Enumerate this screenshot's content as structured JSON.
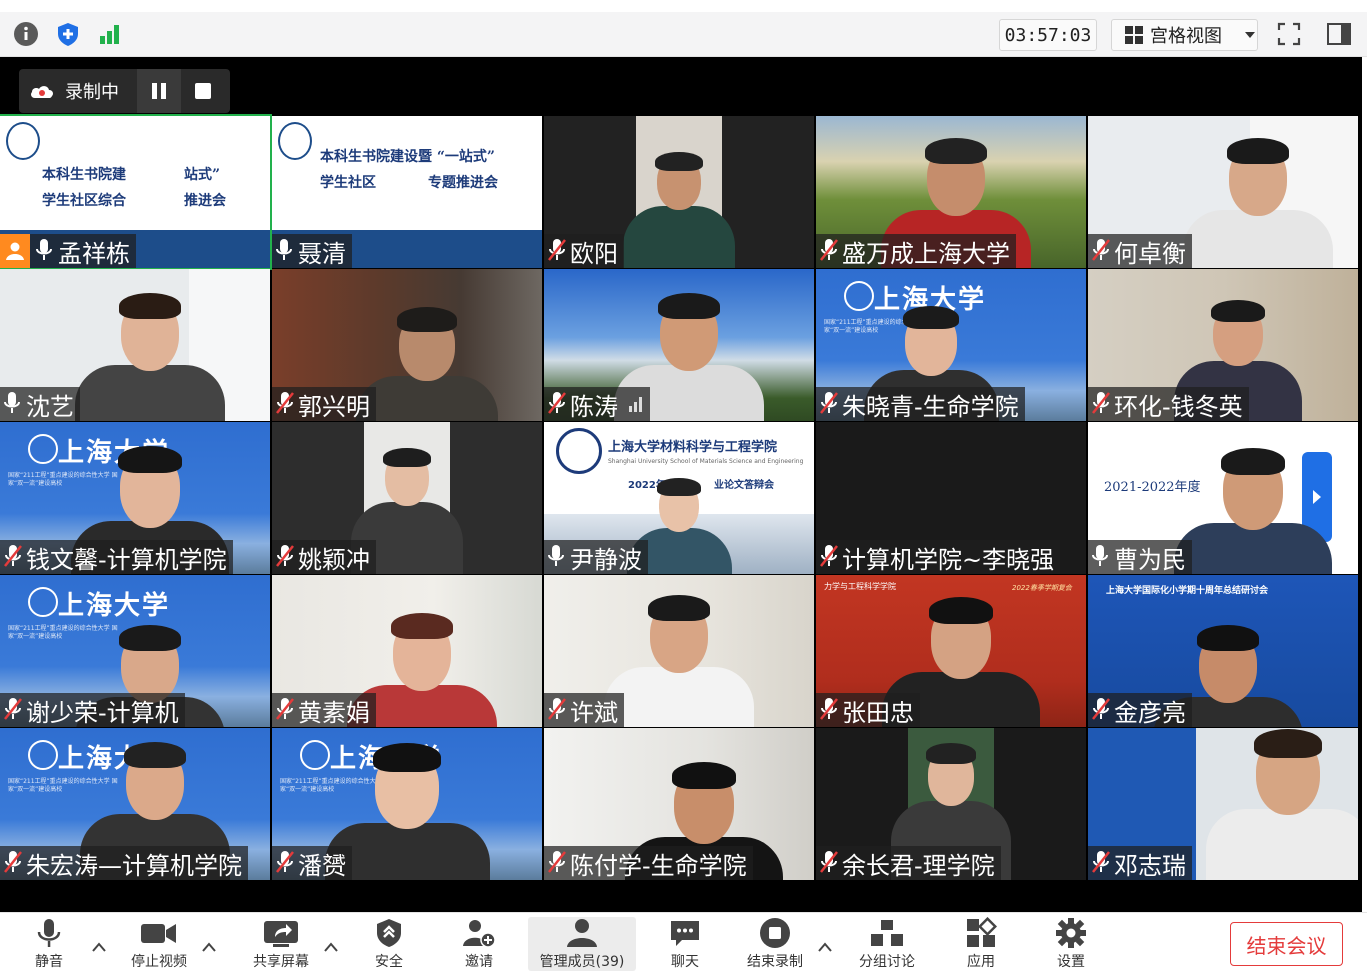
{
  "topbar": {
    "timer": "03:57:03",
    "view_label": "宫格视图",
    "icons": [
      "info-icon",
      "shield-icon",
      "signal-icon",
      "grid-icon",
      "fullscreen-icon",
      "sidebar-toggle-icon"
    ]
  },
  "recording": {
    "label": "录制中"
  },
  "participants": [
    {
      "name": "孟祥栋",
      "muted": false,
      "host": true
    },
    {
      "name": "聂清",
      "muted": false
    },
    {
      "name": "欧阳",
      "muted": true
    },
    {
      "name": "盛万成上海大学",
      "muted": true
    },
    {
      "name": "何卓衡",
      "muted": true
    },
    {
      "name": "沈艺",
      "muted": false
    },
    {
      "name": "郭兴明",
      "muted": true
    },
    {
      "name": "陈涛",
      "muted": true,
      "signal": true
    },
    {
      "name": "朱晓青-生命学院",
      "muted": true
    },
    {
      "name": "环化-钱冬英",
      "muted": true
    },
    {
      "name": "钱文馨-计算机学院",
      "muted": true
    },
    {
      "name": "姚颖冲",
      "muted": true
    },
    {
      "name": "尹静波",
      "muted": false
    },
    {
      "name": "计算机学院~李晓强",
      "muted": true
    },
    {
      "name": "曹为民",
      "muted": false
    },
    {
      "name": "谢少荣-计算机",
      "muted": true
    },
    {
      "name": "黄素娟",
      "muted": true
    },
    {
      "name": "许斌",
      "muted": true
    },
    {
      "name": "张田忠",
      "muted": true
    },
    {
      "name": "金彦亮",
      "muted": true
    },
    {
      "name": "朱宏涛—计算机学院",
      "muted": true
    },
    {
      "name": "潘赟",
      "muted": true
    },
    {
      "name": "陈付学-生命学院",
      "muted": true
    },
    {
      "name": "余长君-理学院",
      "muted": true
    },
    {
      "name": "邓志瑞",
      "muted": true
    }
  ],
  "slides": {
    "t1_line1": "本科生书院建",
    "t1_line1b": "站式”",
    "t1_line2": "学生社区综合",
    "t1_line2b": "推进会",
    "t2_line1": "本科生书院建设暨 “一站式”",
    "t2_line2": "学生社区",
    "t2_line2b": "专题推进会",
    "shu": "上海大学",
    "mat_title": "上海大学材料科学与工程学院",
    "mat_sub": "Shanghai University School of Materials Science and Engineering",
    "mat_year": "2022年",
    "mat_event": "业论文答辩会",
    "cs_year": "2021-2022年度",
    "mech": "力学与工程科学学院",
    "mech_right": "2022春季学期复会",
    "intl": "上海大学国际化小学期十周年总结研讨会",
    "small_text": "国家“211工程”重点建设的综合性大学 国家“双一流”建设高校"
  },
  "bottombar": {
    "items": [
      {
        "label": "静音",
        "icon": "microphone-icon"
      },
      {
        "label": "停止视频",
        "icon": "video-camera-icon"
      },
      {
        "label": "共享屏幕",
        "icon": "share-screen-icon"
      },
      {
        "label": "安全",
        "icon": "security-shield-icon"
      },
      {
        "label": "邀请",
        "icon": "invite-user-icon"
      },
      {
        "label": "管理成员(39)",
        "icon": "participants-icon"
      },
      {
        "label": "聊天",
        "icon": "chat-icon"
      },
      {
        "label": "结束录制",
        "icon": "stop-record-icon"
      },
      {
        "label": "分组讨论",
        "icon": "breakout-icon"
      },
      {
        "label": "应用",
        "icon": "apps-icon"
      },
      {
        "label": "设置",
        "icon": "settings-gear-icon"
      }
    ],
    "end_label": "结束会议"
  },
  "colors": {
    "end_red": "#e43b3b",
    "shu_blue": "#2e6fd1",
    "accent_blue": "#1f6fe5"
  }
}
